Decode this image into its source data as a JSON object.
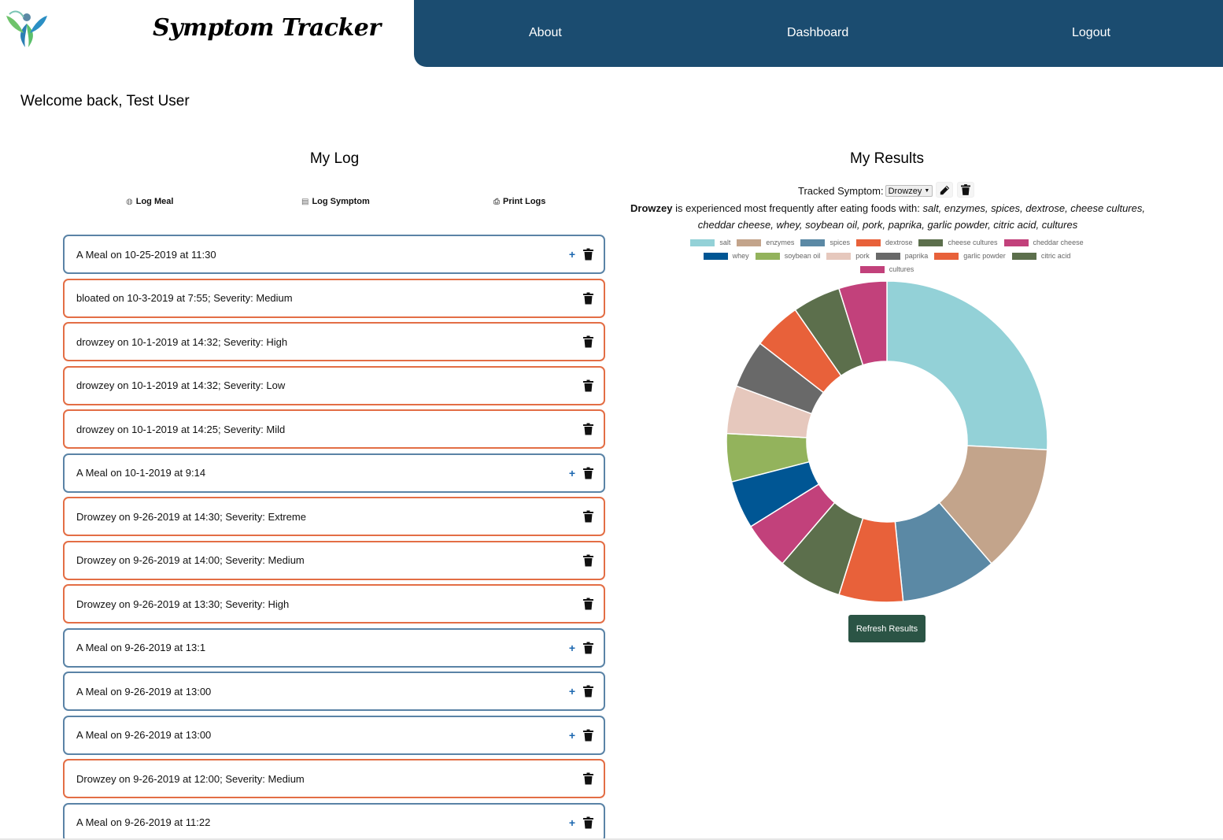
{
  "header": {
    "brand": "Symptom Tracker",
    "nav": [
      "About",
      "Dashboard",
      "Logout"
    ],
    "nav_bg": "#1b4c70"
  },
  "welcome": "Welcome back, Test User",
  "log": {
    "title": "My Log",
    "actions": [
      {
        "label": "Log Meal",
        "icon": "meal-icon"
      },
      {
        "label": "Log Symptom",
        "icon": "clipboard-icon"
      },
      {
        "label": "Print Logs",
        "icon": "printer-icon"
      }
    ],
    "entries": [
      {
        "text": "A Meal on 10-25-2019 at 11:30",
        "kind": "meal"
      },
      {
        "text": "bloated on 10-3-2019 at 7:55; Severity: Medium",
        "kind": "symptom"
      },
      {
        "text": "drowzey on 10-1-2019 at 14:32; Severity: High",
        "kind": "symptom"
      },
      {
        "text": "drowzey on 10-1-2019 at 14:32; Severity: Low",
        "kind": "symptom"
      },
      {
        "text": "drowzey on 10-1-2019 at 14:25; Severity: Mild",
        "kind": "symptom"
      },
      {
        "text": "A Meal on 10-1-2019 at 9:14",
        "kind": "meal"
      },
      {
        "text": "Drowzey on 9-26-2019 at 14:30; Severity: Extreme",
        "kind": "symptom"
      },
      {
        "text": "Drowzey on 9-26-2019 at 14:00; Severity: Medium",
        "kind": "symptom"
      },
      {
        "text": "Drowzey on 9-26-2019 at 13:30; Severity: High",
        "kind": "symptom"
      },
      {
        "text": "A Meal on 9-26-2019 at 13:1",
        "kind": "meal"
      },
      {
        "text": "A Meal on 9-26-2019 at 13:00",
        "kind": "meal"
      },
      {
        "text": "A Meal on 9-26-2019 at 13:00",
        "kind": "meal"
      },
      {
        "text": "Drowzey on 9-26-2019 at 12:00; Severity: Medium",
        "kind": "symptom"
      },
      {
        "text": "A Meal on 9-26-2019 at 11:22",
        "kind": "meal"
      }
    ],
    "meal_border": "#5a83a6",
    "symptom_border": "#e36e45"
  },
  "results": {
    "title": "My Results",
    "tracked_label": "Tracked Symptom:",
    "tracked_value": "Drowzey",
    "summary_symptom": "Drowzey",
    "summary_text": " is experienced most frequently after eating foods with: ",
    "summary_foods": "salt, enzymes, spices, dextrose, cheese cultures, cheddar cheese, whey, soybean oil, pork, paprika, garlic powder, citric acid, cultures",
    "refresh_label": "Refresh Results"
  },
  "chart_data": {
    "type": "pie",
    "donut": true,
    "title": "",
    "legend_position": "top",
    "categories": [
      "salt",
      "enzymes",
      "spices",
      "dextrose",
      "cheese cultures",
      "cheddar cheese",
      "whey",
      "soybean oil",
      "pork",
      "paprika",
      "garlic powder",
      "citric acid",
      "cultures"
    ],
    "values": [
      8,
      4,
      3,
      2,
      2,
      1.5,
      1.5,
      1.5,
      1.5,
      1.5,
      1.5,
      1.5,
      1.5
    ],
    "colors": [
      "#93d1d7",
      "#c3a48b",
      "#5b89a5",
      "#e8613a",
      "#5c6f4c",
      "#c2417b",
      "#005694",
      "#93b35c",
      "#e6c8bd",
      "#696969",
      "#e8613a",
      "#5c6f4c",
      "#c2417b"
    ]
  }
}
